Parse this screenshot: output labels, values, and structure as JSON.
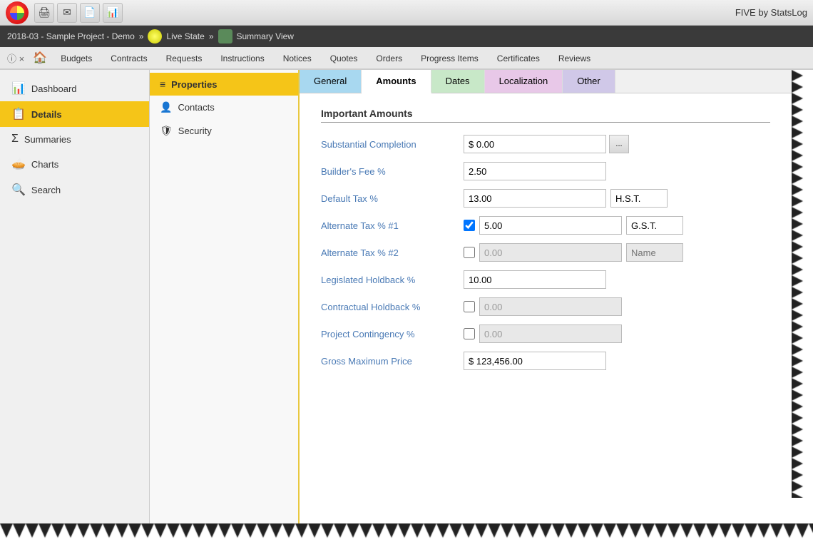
{
  "titleBar": {
    "brand": "FIVE by StatsLog",
    "icons": [
      "🖨",
      "✉",
      "📄",
      "📊"
    ]
  },
  "breadcrumb": {
    "project": "2018-03 - Sample Project - Demo",
    "state": "Live State",
    "view": "Summary View",
    "sep": "»"
  },
  "navTabs": {
    "close_label": "×",
    "home_icon": "🏠",
    "items": [
      {
        "label": "Budgets",
        "active": false
      },
      {
        "label": "Contracts",
        "active": false
      },
      {
        "label": "Requests",
        "active": false
      },
      {
        "label": "Instructions",
        "active": false
      },
      {
        "label": "Notices",
        "active": false
      },
      {
        "label": "Quotes",
        "active": false
      },
      {
        "label": "Orders",
        "active": false
      },
      {
        "label": "Progress Items",
        "active": false
      },
      {
        "label": "Certificates",
        "active": false
      },
      {
        "label": "Reviews",
        "active": false
      }
    ]
  },
  "sidebar": {
    "items": [
      {
        "label": "Dashboard",
        "icon": "📊",
        "active": false
      },
      {
        "label": "Details",
        "icon": "📋",
        "active": true
      },
      {
        "label": "Summaries",
        "icon": "Σ",
        "active": false
      },
      {
        "label": "Charts",
        "icon": "🥧",
        "active": false
      },
      {
        "label": "Search",
        "icon": "🔍",
        "active": false
      }
    ]
  },
  "middlePanel": {
    "items": [
      {
        "label": "Properties",
        "icon": "≡",
        "active": true
      },
      {
        "label": "Contacts",
        "icon": "👤",
        "active": false
      },
      {
        "label": "Security",
        "icon": "🛡",
        "active": false
      }
    ]
  },
  "contentTabs": [
    {
      "label": "General",
      "class": "general",
      "active": false
    },
    {
      "label": "Amounts",
      "class": "amounts",
      "active": true
    },
    {
      "label": "Dates",
      "class": "dates",
      "active": false
    },
    {
      "label": "Localization",
      "class": "localization",
      "active": false
    },
    {
      "label": "Other",
      "class": "other",
      "active": false
    }
  ],
  "form": {
    "sectionTitle": "Important Amounts",
    "fields": [
      {
        "label": "Substantial Completion",
        "inputType": "currency",
        "value": "$ 0.00",
        "hasButton": true,
        "buttonLabel": "...",
        "disabled": false
      },
      {
        "label": "Builder's Fee %",
        "inputType": "percent",
        "value": "2.50",
        "hasButton": false,
        "disabled": false
      },
      {
        "label": "Default Tax %",
        "inputType": "percent",
        "value": "13.00",
        "secondaryValue": "H.S.T.",
        "hasButton": false,
        "disabled": false
      },
      {
        "label": "Alternate Tax % #1",
        "inputType": "percent",
        "value": "5.00",
        "secondaryValue": "G.S.T.",
        "hasCheckbox": true,
        "checkboxChecked": true,
        "disabled": false
      },
      {
        "label": "Alternate Tax % #2",
        "inputType": "percent",
        "value": "0.00",
        "secondaryValue": "Name",
        "secondaryDisabled": true,
        "hasCheckbox": true,
        "checkboxChecked": false,
        "disabled": true
      },
      {
        "label": "Legislated Holdback %",
        "inputType": "percent",
        "value": "10.00",
        "hasButton": false,
        "disabled": false
      },
      {
        "label": "Contractual Holdback %",
        "inputType": "percent",
        "value": "0.00",
        "hasCheckbox": true,
        "checkboxChecked": false,
        "disabled": true
      },
      {
        "label": "Project Contingency %",
        "inputType": "percent",
        "value": "0.00",
        "hasCheckbox": true,
        "checkboxChecked": false,
        "disabled": true
      },
      {
        "label": "Gross Maximum Price",
        "inputType": "currency",
        "value": "$ 123,456.00",
        "hasButton": false,
        "disabled": false
      }
    ]
  }
}
